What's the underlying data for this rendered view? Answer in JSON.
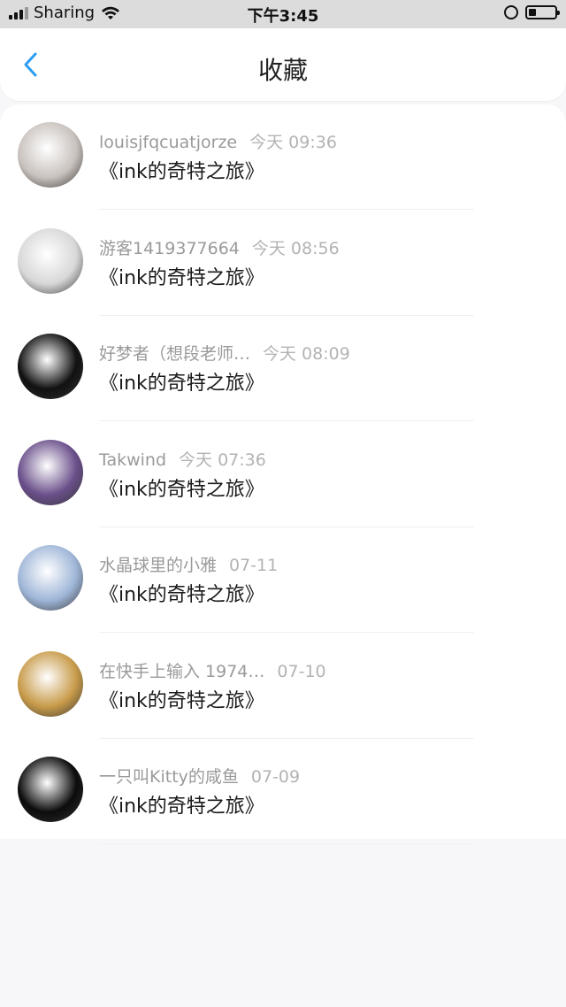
{
  "status_bar": {
    "carrier": "Sharing",
    "time": "下午3:45",
    "battery_level": 0.3
  },
  "header": {
    "title": "收藏",
    "back_icon": "chevron-left-icon",
    "accent_color": "#2a9df4"
  },
  "favorites": [
    {
      "user": "louisjfqcuatjorze",
      "time": "今天 09:36",
      "title": "《ink的奇特之旅》",
      "avatar_color": "#c9c2be"
    },
    {
      "user": "游客1419377664",
      "time": "今天 08:56",
      "title": "《ink的奇特之旅》",
      "avatar_color": "#d8d8d8"
    },
    {
      "user": "好梦者（想段老师…",
      "time": "今天 08:09",
      "title": "《ink的奇特之旅》",
      "avatar_color": "#111111"
    },
    {
      "user": "Takwind",
      "time": "今天 07:36",
      "title": "《ink的奇特之旅》",
      "avatar_color": "#6a4f8a"
    },
    {
      "user": "水晶球里的小雅",
      "time": "07-11",
      "title": "《ink的奇特之旅》",
      "avatar_color": "#9fb6d8"
    },
    {
      "user": "在快手上输入 1974…",
      "time": "07-10",
      "title": "《ink的奇特之旅》",
      "avatar_color": "#c89b4a"
    },
    {
      "user": "一只叫Kitty的咸鱼",
      "time": "07-09",
      "title": "《ink的奇特之旅》",
      "avatar_color": "#0c0c0c"
    }
  ]
}
